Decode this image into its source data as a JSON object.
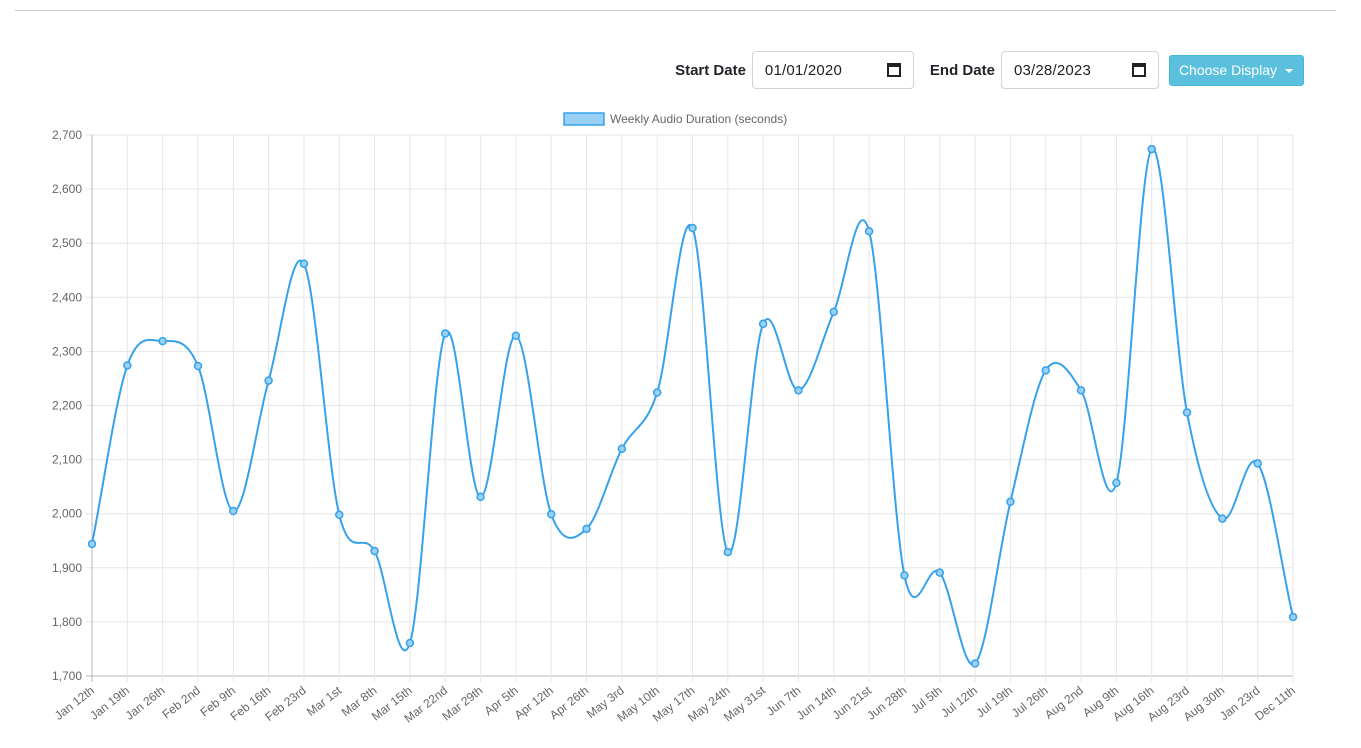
{
  "controls": {
    "start_label": "Start Date",
    "start_value": "01/01/2020",
    "end_label": "End Date",
    "end_value": "03/28/2023",
    "display_button": "Choose Display"
  },
  "chart_data": {
    "type": "line",
    "legend": "Weekly Audio Duration (seconds)",
    "legend_position": "top",
    "color": "#36a2eb",
    "fill_color": "#9ad0f5",
    "grid": true,
    "ylim": [
      1700,
      2700
    ],
    "yticks": [
      "1,700",
      "1,800",
      "1,900",
      "2,000",
      "2,100",
      "2,200",
      "2,300",
      "2,400",
      "2,500",
      "2,600",
      "2,700"
    ],
    "categories": [
      "Jan 12th",
      "Jan 19th",
      "Jan 26th",
      "Feb 2nd",
      "Feb 9th",
      "Feb 16th",
      "Feb 23rd",
      "Mar 1st",
      "Mar 8th",
      "Mar 15th",
      "Mar 22nd",
      "Mar 29th",
      "Apr 5th",
      "Apr 12th",
      "Apr 26th",
      "May 3rd",
      "May 10th",
      "May 17th",
      "May 24th",
      "May 31st",
      "Jun 7th",
      "Jun 14th",
      "Jun 21st",
      "Jun 28th",
      "Jul 5th",
      "Jul 12th",
      "Jul 19th",
      "Jul 26th",
      "Aug 2nd",
      "Aug 9th",
      "Aug 16th",
      "Aug 23rd",
      "Aug 30th",
      "Jan 23rd",
      "Dec 11th"
    ],
    "values": [
      1944,
      2274,
      2319,
      2273,
      2005,
      2246,
      2462,
      1998,
      1931,
      1761,
      2333,
      2031,
      2329,
      1999,
      1972,
      2120,
      2224,
      2528,
      1929,
      2351,
      2228,
      2373,
      2522,
      1886,
      1891,
      1723,
      2022,
      2265,
      2228,
      2057,
      2674,
      2187,
      1991,
      2093,
      1809
    ]
  }
}
